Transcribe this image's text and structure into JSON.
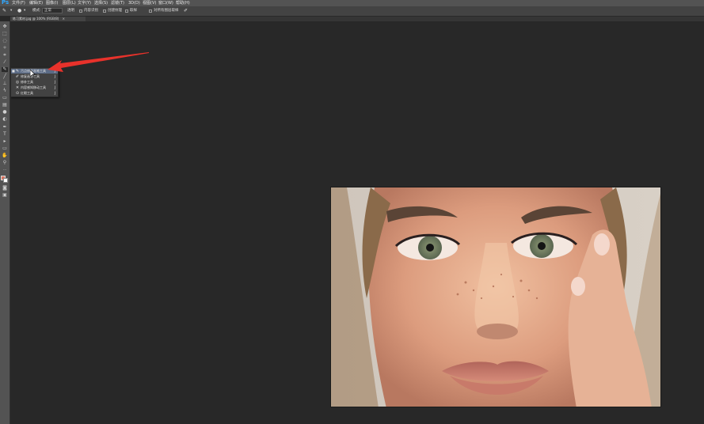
{
  "app": {
    "logo": "Ps"
  },
  "menubar": {
    "items": [
      {
        "label": "文件(F)"
      },
      {
        "label": "编辑(E)"
      },
      {
        "label": "图像(I)"
      },
      {
        "label": "图层(L)"
      },
      {
        "label": "文字(Y)"
      },
      {
        "label": "选择(S)"
      },
      {
        "label": "滤镜(T)"
      },
      {
        "label": "3D(D)"
      },
      {
        "label": "视图(V)"
      },
      {
        "label": "窗口(W)"
      },
      {
        "label": "帮助(H)"
      }
    ]
  },
  "options": {
    "mode_label": "模式:",
    "mode_value": "正常",
    "source_label": "源:",
    "sampled_label": "取样",
    "pattern_label": "图案",
    "transparent_label": "透明",
    "diffusion_label": "扩散",
    "content_aware_label": "内容识别",
    "create_texture_label": "创建纹理",
    "sample_all_label": "对所有图层取样"
  },
  "document": {
    "tab_label": "练习素材.jpg @ 100% (RGB/8)"
  },
  "flyout": {
    "items": [
      {
        "label": "污点修复画笔工具",
        "key": "J",
        "icon": "spot-healing-icon",
        "selected": true
      },
      {
        "label": "修复画笔工具",
        "key": "J",
        "icon": "healing-brush-icon",
        "selected": false
      },
      {
        "label": "修补工具",
        "key": "J",
        "icon": "patch-icon",
        "selected": false
      },
      {
        "label": "内容感知移动工具",
        "key": "J",
        "icon": "content-aware-move-icon",
        "selected": false
      },
      {
        "label": "红眼工具",
        "key": "J",
        "icon": "red-eye-icon",
        "selected": false
      }
    ]
  },
  "colors": {
    "foreground": "#d9735f",
    "background": "#ffffff",
    "annotation_arrow": "#e8322b",
    "selection": "#5b6b85"
  }
}
